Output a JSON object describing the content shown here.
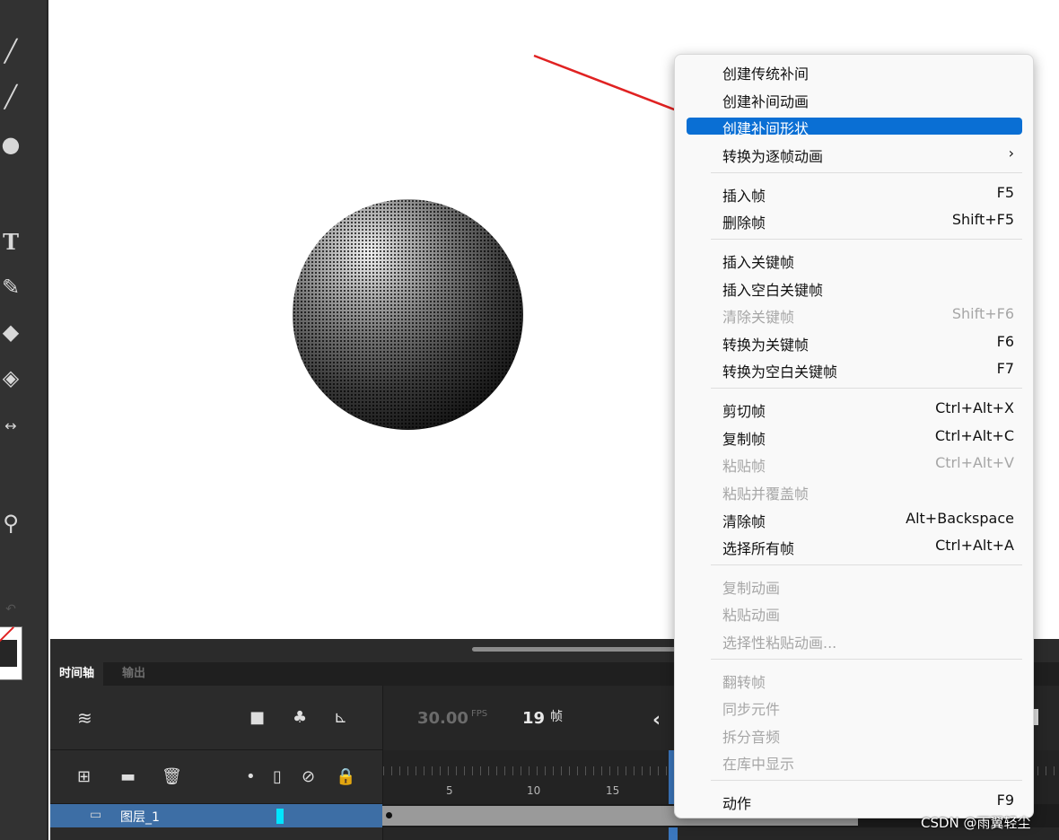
{
  "toolbar": {
    "tools": [
      "brush-icon",
      "paint-brush-icon",
      "oval-icon",
      "text-icon",
      "eyedropper-icon",
      "pen-icon",
      "subselect-icon",
      "width-icon",
      "zoom-icon",
      "rotate-icon"
    ]
  },
  "context_menu": {
    "items": [
      {
        "label": "创建传统补间",
        "shortcut": "",
        "disabled": false
      },
      {
        "label": "创建补间动画",
        "shortcut": "",
        "disabled": false
      },
      {
        "label": "创建补间形状",
        "shortcut": "",
        "disabled": false,
        "highlighted": true
      },
      {
        "label": "转换为逐帧动画",
        "shortcut": "›",
        "disabled": false
      },
      {
        "label": "插入帧",
        "shortcut": "F5",
        "disabled": false
      },
      {
        "label": "删除帧",
        "shortcut": "Shift+F5",
        "disabled": false
      },
      {
        "label": "插入关键帧",
        "shortcut": "",
        "disabled": false
      },
      {
        "label": "插入空白关键帧",
        "shortcut": "",
        "disabled": false
      },
      {
        "label": "清除关键帧",
        "shortcut": "Shift+F6",
        "disabled": true
      },
      {
        "label": "转换为关键帧",
        "shortcut": "F6",
        "disabled": false
      },
      {
        "label": "转换为空白关键帧",
        "shortcut": "F7",
        "disabled": false
      },
      {
        "label": "剪切帧",
        "shortcut": "Ctrl+Alt+X",
        "disabled": false
      },
      {
        "label": "复制帧",
        "shortcut": "Ctrl+Alt+C",
        "disabled": false
      },
      {
        "label": "粘贴帧",
        "shortcut": "Ctrl+Alt+V",
        "disabled": true
      },
      {
        "label": "粘贴并覆盖帧",
        "shortcut": "",
        "disabled": true
      },
      {
        "label": "清除帧",
        "shortcut": "Alt+Backspace",
        "disabled": false
      },
      {
        "label": "选择所有帧",
        "shortcut": "Ctrl+Alt+A",
        "disabled": false
      },
      {
        "label": "复制动画",
        "shortcut": "",
        "disabled": true
      },
      {
        "label": "粘贴动画",
        "shortcut": "",
        "disabled": true
      },
      {
        "label": "选择性粘贴动画...",
        "shortcut": "",
        "disabled": true
      },
      {
        "label": "翻转帧",
        "shortcut": "",
        "disabled": true
      },
      {
        "label": "同步元件",
        "shortcut": "",
        "disabled": true
      },
      {
        "label": "拆分音频",
        "shortcut": "",
        "disabled": true
      },
      {
        "label": "在库中显示",
        "shortcut": "",
        "disabled": true
      },
      {
        "label": "动作",
        "shortcut": "F9",
        "disabled": false
      }
    ]
  },
  "timeline": {
    "tabs": [
      "时间轴",
      "输出"
    ],
    "fps_value": "30.00",
    "fps_unit": "FPS",
    "current_frame": "19",
    "frame_unit": "帧",
    "ruler_numbers": [
      "5",
      "10",
      "15"
    ],
    "layer": {
      "name": "图层_1"
    }
  },
  "watermark": "CSDN @雨翼轻尘",
  "colors": {
    "highlight": "#0a6fd4",
    "layer_row": "#3d6ea5",
    "arrow": "#e02222",
    "playhead": "#3f86d9"
  }
}
